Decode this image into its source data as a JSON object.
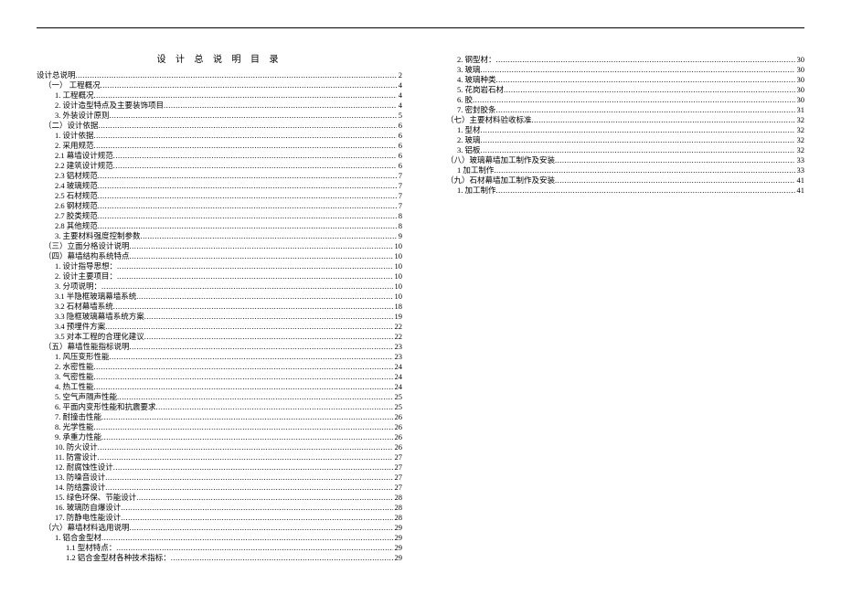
{
  "title": "设 计 总 说 明 目 录",
  "toc": [
    {
      "label": "设计总说明",
      "page": "2",
      "level": 0
    },
    {
      "label": "（一）  工程概况",
      "page": "4",
      "level": 1
    },
    {
      "label": "1.    工程概况",
      "page": "4",
      "level": 2
    },
    {
      "label": "2.    设计造型特点及主要装饰项目",
      "page": "4",
      "level": 2
    },
    {
      "label": "3.    外装设计原则",
      "page": "5",
      "level": 2
    },
    {
      "label": "（二）设计依据",
      "page": "6",
      "level": 1
    },
    {
      "label": "1. 设计依据",
      "page": "6",
      "level": 2
    },
    {
      "label": "2. 采用规范",
      "page": "6",
      "level": 2
    },
    {
      "label": "2.1 幕墙设计规范",
      "page": "6",
      "level": 2
    },
    {
      "label": "2.2 建筑设计规范",
      "page": "6",
      "level": 2
    },
    {
      "label": "2.3 铝材规范",
      "page": "7",
      "level": 2
    },
    {
      "label": "2.4 玻璃规范",
      "page": "7",
      "level": 2
    },
    {
      "label": "2.5 石材规范",
      "page": "7",
      "level": 2
    },
    {
      "label": "2.6 钢材规范",
      "page": "7",
      "level": 2
    },
    {
      "label": "2.7 胶类规范",
      "page": "8",
      "level": 2
    },
    {
      "label": "2.8 其他规范",
      "page": "8",
      "level": 2
    },
    {
      "label": "3. 主要材料强度控制参数",
      "page": "9",
      "level": 2
    },
    {
      "label": "（三）立面分格设计说明",
      "page": "10",
      "level": 1
    },
    {
      "label": "（四）幕墙结构系统特点",
      "page": "10",
      "level": 1
    },
    {
      "label": "1. 设计指导思想：",
      "page": "10",
      "level": 2
    },
    {
      "label": "2. 设计主要项目：",
      "page": "10",
      "level": 2
    },
    {
      "label": "3. 分项说明：",
      "page": "10",
      "level": 2
    },
    {
      "label": "3.1 半隐框玻璃幕墙系统",
      "page": "10",
      "level": 2
    },
    {
      "label": "3.2 石材幕墙系统",
      "page": "18",
      "level": 2
    },
    {
      "label": "3.3 隐框玻璃幕墙系统方案",
      "page": "19",
      "level": 2
    },
    {
      "label": "3.4 预埋件方案",
      "page": "22",
      "level": 2
    },
    {
      "label": "3.5 对本工程的合理化建议",
      "page": "22",
      "level": 2
    },
    {
      "label": "（五）幕墙性能指标说明",
      "page": "23",
      "level": 1
    },
    {
      "label": "1. 风压变形性能",
      "page": "23",
      "level": 2
    },
    {
      "label": "2. 水密性能",
      "page": "24",
      "level": 2
    },
    {
      "label": "3. 气密性能",
      "page": "24",
      "level": 2
    },
    {
      "label": "4. 热工性能",
      "page": "24",
      "level": 2
    },
    {
      "label": "5. 空气声隔声性能",
      "page": "25",
      "level": 2
    },
    {
      "label": "6. 平面内变形性能和抗震要求",
      "page": "25",
      "level": 2
    },
    {
      "label": "7. 耐撞击性能",
      "page": "26",
      "level": 2
    },
    {
      "label": "8. 光学性能",
      "page": "26",
      "level": 2
    },
    {
      "label": "9. 承重力性能",
      "page": "26",
      "level": 2
    },
    {
      "label": "10. 防火设计",
      "page": "26",
      "level": 2
    },
    {
      "label": "11. 防雷设计",
      "page": "27",
      "level": 2
    },
    {
      "label": "12. 耐腐蚀性设计",
      "page": "27",
      "level": 2
    },
    {
      "label": "13. 防噪音设计",
      "page": "27",
      "level": 2
    },
    {
      "label": "14. 防结露设计",
      "page": "27",
      "level": 2
    },
    {
      "label": "15. 绿色环保、节能设计",
      "page": "28",
      "level": 2
    },
    {
      "label": "16. 玻璃防自爆设计",
      "page": "28",
      "level": 2
    },
    {
      "label": "17. 防静电性能设计",
      "page": "28",
      "level": 2
    },
    {
      "label": "（六）幕墙材料选用说明",
      "page": "29",
      "level": 1
    },
    {
      "label": "1. 铝合金型材",
      "page": "29",
      "level": 2
    },
    {
      "label": "1.1   型材特点：",
      "page": "29",
      "level": 3
    },
    {
      "label": "1.2   铝合金型材各种技术指标：",
      "page": "29",
      "level": 3
    },
    {
      "label": "2. 钢型材：",
      "page": "30",
      "level": 2
    },
    {
      "label": "3. 玻璃",
      "page": "30",
      "level": 2
    },
    {
      "label": "4. 玻璃种类",
      "page": "30",
      "level": 2
    },
    {
      "label": "5. 花岗岩石材",
      "page": "30",
      "level": 2
    },
    {
      "label": "6.    胶",
      "page": "30",
      "level": 2
    },
    {
      "label": "7. 密封胶条",
      "page": "31",
      "level": 2
    },
    {
      "label": "（七）主要材料验收标准",
      "page": "32",
      "level": 1
    },
    {
      "label": "1. 型材",
      "page": "32",
      "level": 2
    },
    {
      "label": "2. 玻璃",
      "page": "32",
      "level": 2
    },
    {
      "label": "3. 铝板",
      "page": "32",
      "level": 2
    },
    {
      "label": "（八）玻璃幕墙加工制作及安装",
      "page": "33",
      "level": 1
    },
    {
      "label": "1 加工制作",
      "page": "33",
      "level": 2
    },
    {
      "label": "（九）石材幕墙加工制作及安装",
      "page": "41",
      "level": 1
    },
    {
      "label": "1. 加工制作",
      "page": "41",
      "level": 2
    }
  ]
}
